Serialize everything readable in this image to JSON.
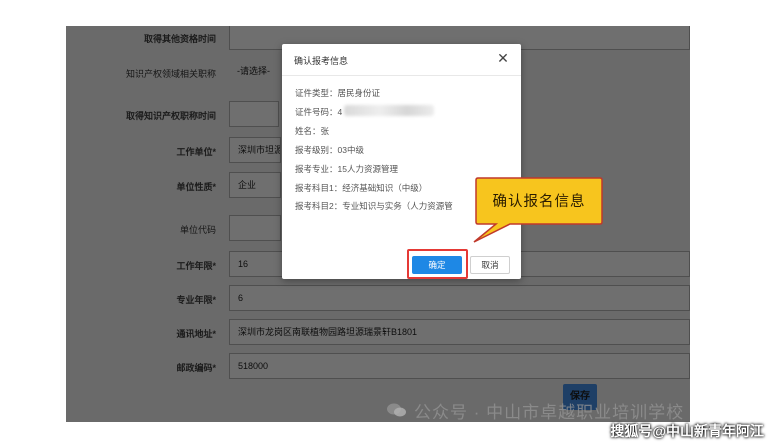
{
  "form": {
    "rows": [
      {
        "label": "取得其他资格时间",
        "value": ""
      },
      {
        "label": "知识产权领域相关职称",
        "value": "-请选择-"
      },
      {
        "label": "取得知识产权职称时间",
        "value": ""
      },
      {
        "label": "工作单位*",
        "value": "深圳市坦源"
      },
      {
        "label": "单位性质*",
        "value": "企业"
      },
      {
        "label": "单位代码",
        "value": ""
      },
      {
        "label": "工作年限*",
        "value": "16"
      },
      {
        "label": "专业年限*",
        "value": "6"
      },
      {
        "label": "通讯地址*",
        "value": "深圳市龙岗区南联植物园路坦源瑞景轩B1801"
      },
      {
        "label": "邮政编码*",
        "value": "518000"
      }
    ],
    "save_label": "保存"
  },
  "modal": {
    "title": "确认报考信息",
    "close_symbol": "✕",
    "fields": [
      "证件类型：居民身份证",
      "证件号码：4",
      "姓名：张",
      "报考级别：03中级",
      "报考专业：15人力资源管理",
      "报考科目1：经济基础知识（中级）",
      "报考科目2：专业知识与实务（人力资源管"
    ],
    "confirm_label": "确定",
    "cancel_label": "取消"
  },
  "callout": {
    "text": "确认报名信息"
  },
  "watermark": {
    "center": "公众号 · 中山市卓越职业培训学校",
    "corner": "搜狐号@中山新青年阿江"
  },
  "colors": {
    "overlay": "#6a6a6a",
    "primary": "#1e88e5",
    "highlight": "#e53935",
    "callout_fill": "#f7c51e",
    "callout_border": "#c0392b"
  }
}
